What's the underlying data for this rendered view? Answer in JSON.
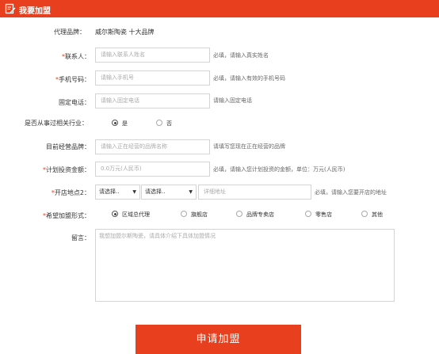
{
  "header": {
    "title": "我要加盟",
    "icon": "edit-icon",
    "color": "#e8401e"
  },
  "form": {
    "agent_brand": {
      "label": "代理品牌：",
      "value": "威尔斯陶瓷  十大品牌"
    },
    "contact": {
      "required": "*",
      "label": "联系人：",
      "placeholder": "请输入联系人姓名",
      "hint": "必填，请输入真实姓名"
    },
    "mobile": {
      "required": "*",
      "label": "手机号码：",
      "placeholder": "请输入手机号",
      "hint": "必填，请输入有效的手机号码"
    },
    "phone": {
      "label": "固定电话：",
      "placeholder": "请输入固定电话",
      "hint": "请输入固定电话"
    },
    "industry": {
      "label": "是否从事过相关行业：",
      "options": [
        "是",
        "否"
      ],
      "selected": "是"
    },
    "current_brand": {
      "label": "目前经营品牌：",
      "placeholder": "请输入正在经营的品牌名称",
      "hint": "请填写您现在正在经营的品牌"
    },
    "investment": {
      "required": "*",
      "label": "计划投资金额：",
      "placeholder": "0.0万元(人民币)",
      "hint": "必填，请输入您计划投资的金额，单位：万元(人民币)"
    },
    "location": {
      "required": "*",
      "label": "开店地点2：",
      "province": "请选择..",
      "city": "请选择..",
      "address_placeholder": "详细地址",
      "hint": "必填，请输入您要开店的地址"
    },
    "form_type": {
      "required": "*",
      "label": "希望加盟形式：",
      "options": [
        "区域总代理",
        "旗舰店",
        "品牌专卖店",
        "零售店",
        "其他"
      ],
      "selected": "区域总代理"
    },
    "message": {
      "label": "留言：",
      "placeholder": "我想加盟尔斯陶瓷，请具体介绍下具体加盟情况"
    },
    "submit_label": "申请加盟"
  }
}
